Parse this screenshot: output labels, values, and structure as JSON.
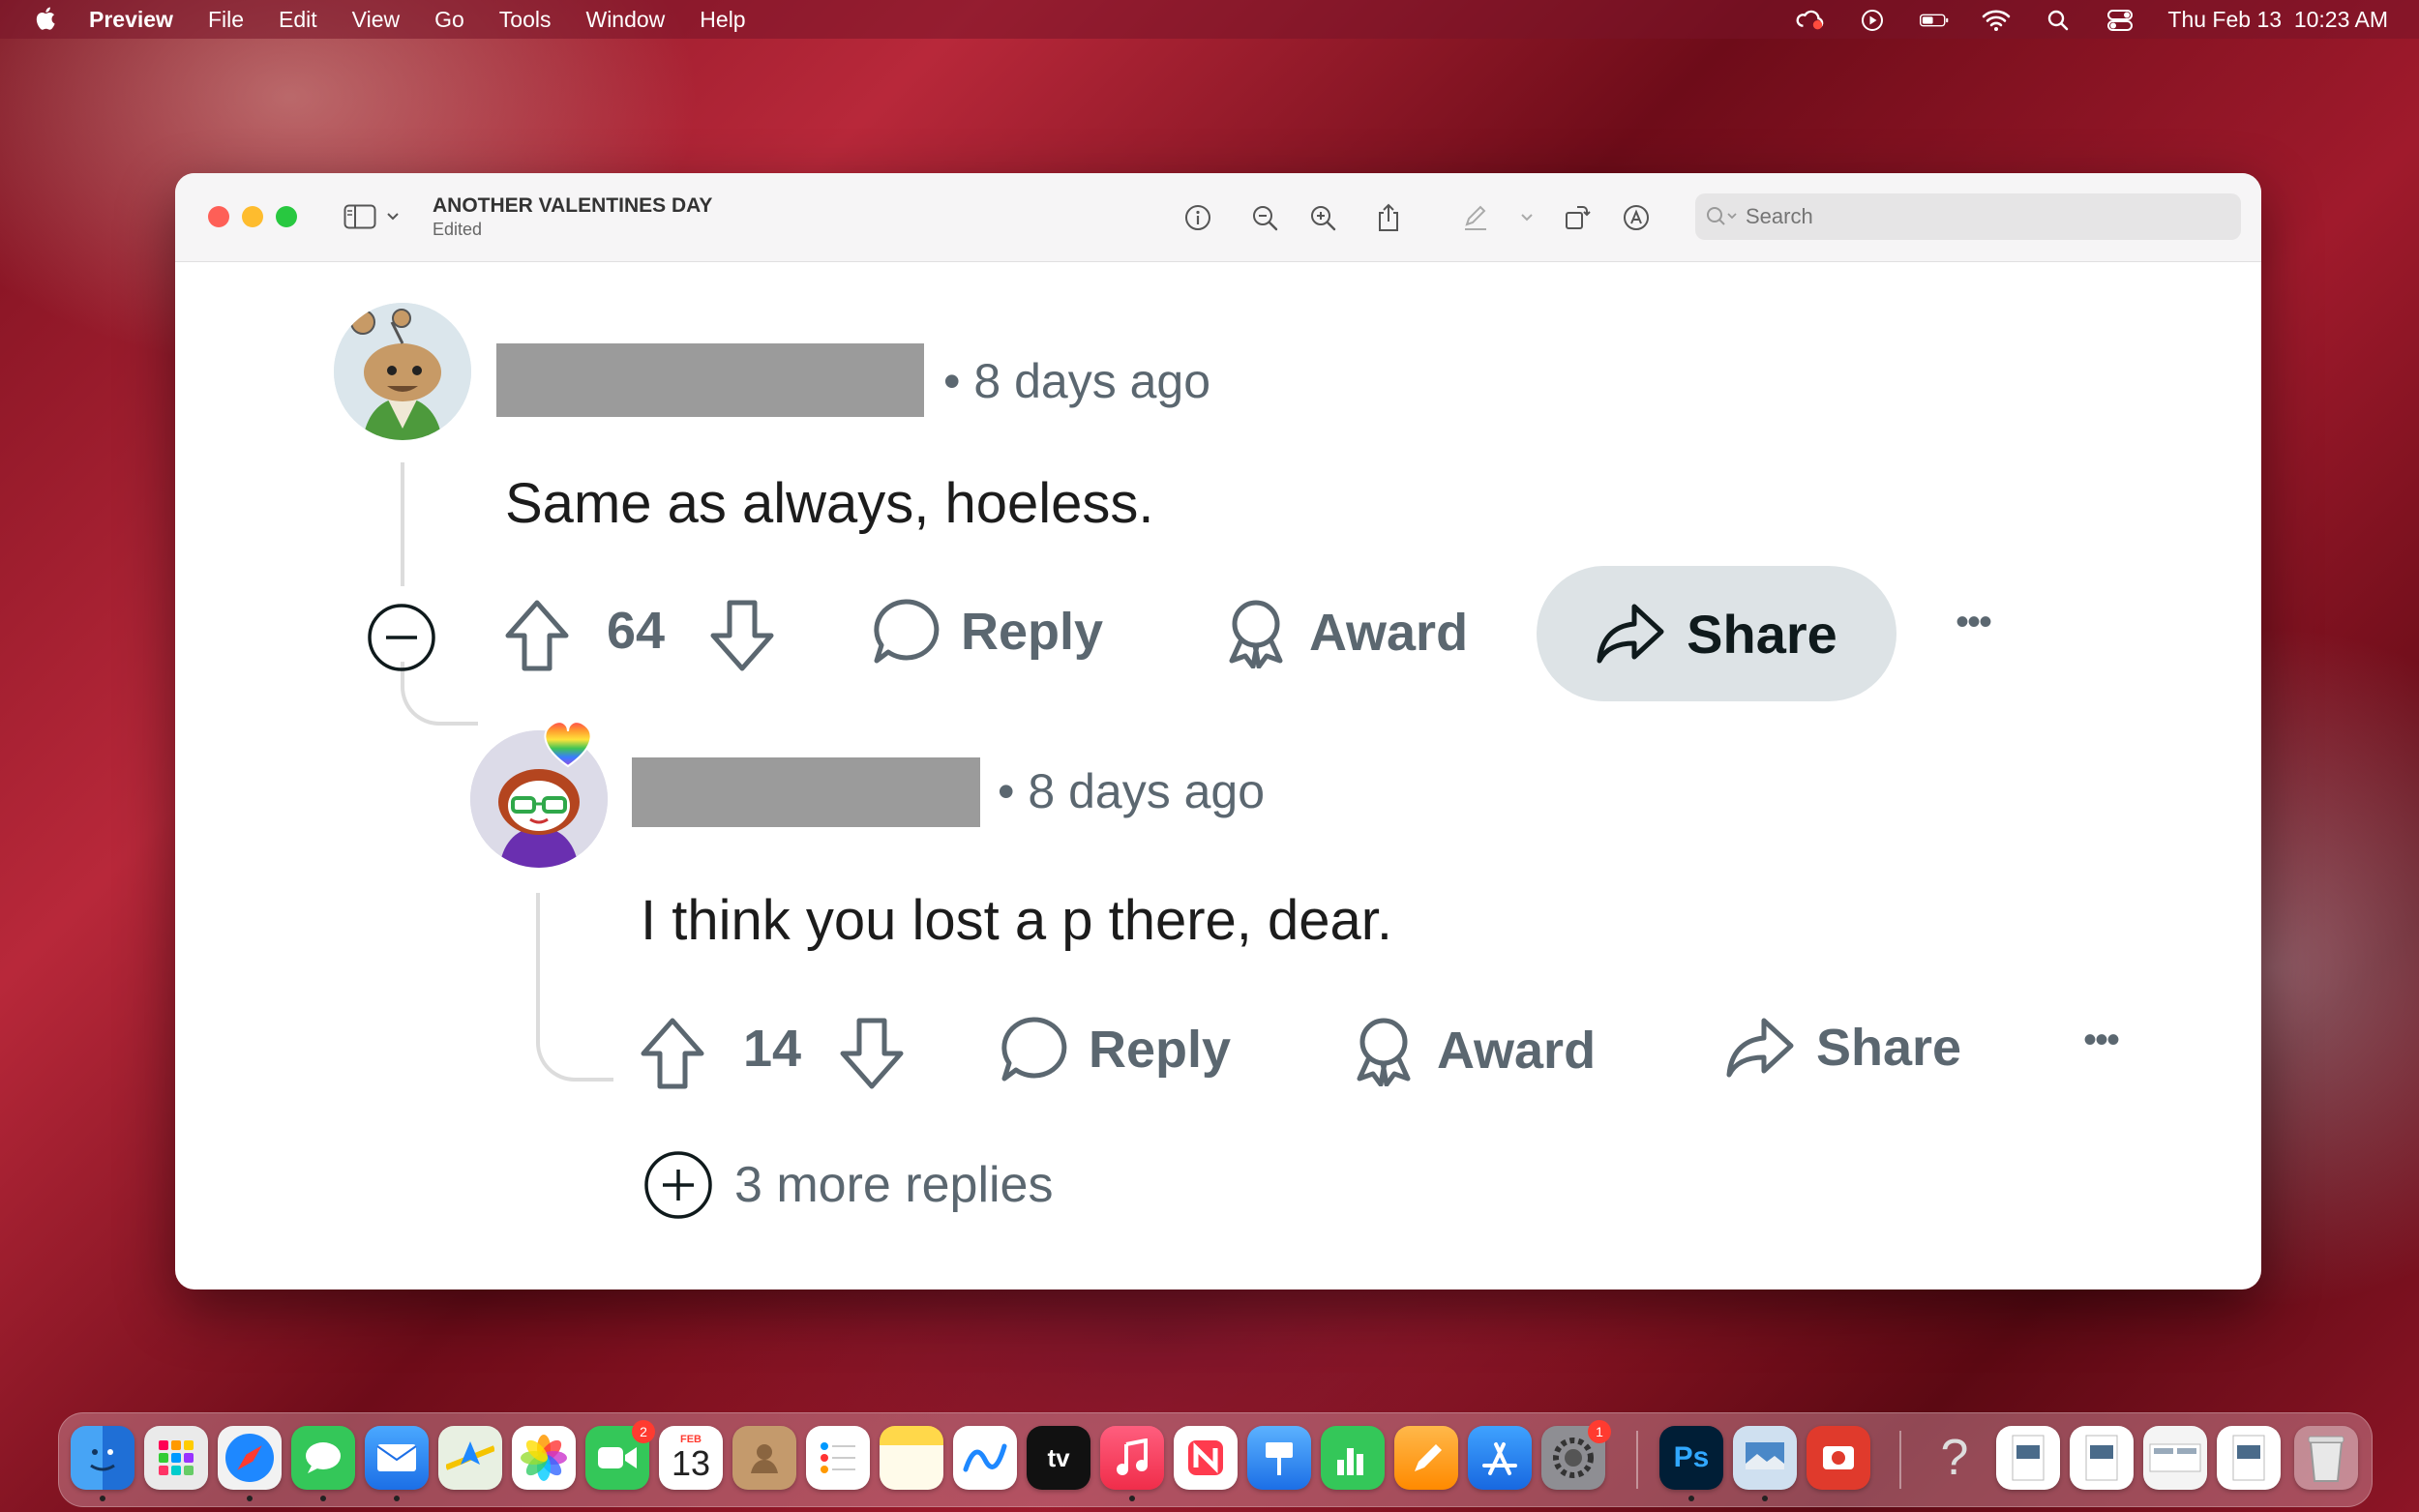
{
  "menubar": {
    "app_name": "Preview",
    "menus": [
      "File",
      "Edit",
      "View",
      "Go",
      "Tools",
      "Window",
      "Help"
    ],
    "datetime": "Thu Feb 13  10:23 AM",
    "status_icons": [
      "creative-cloud-icon",
      "play-icon",
      "battery-icon",
      "wifi-icon",
      "spotlight-search-icon",
      "control-center-icon"
    ]
  },
  "window": {
    "doc_title": "ANOTHER VALENTINES DAY",
    "doc_subtitle": "Edited",
    "search_placeholder": "Search"
  },
  "comment1": {
    "time": "• 8 days ago",
    "body": "Same as always, hoeless.",
    "votes": "64",
    "reply_label": "Reply",
    "award_label": "Award",
    "share_label": "Share",
    "more_label": "•••"
  },
  "comment2": {
    "time": "• 8 days ago",
    "body": "I think you lost a p there, dear.",
    "votes": "14",
    "reply_label": "Reply",
    "award_label": "Award",
    "share_label": "Share",
    "more_label": "•••"
  },
  "more_replies": "3 more replies",
  "dock": {
    "facetime_badge": "2",
    "settings_badge": "1",
    "calendar_month": "FEB",
    "calendar_day": "13",
    "tv_label": "tv",
    "photoshop_label": "Ps",
    "trash_label": "",
    "help_label": "?"
  },
  "colors": {
    "meta_gray": "#5b6770",
    "share_pill": "#dde3e6",
    "redaction": "#9b9b9b"
  }
}
